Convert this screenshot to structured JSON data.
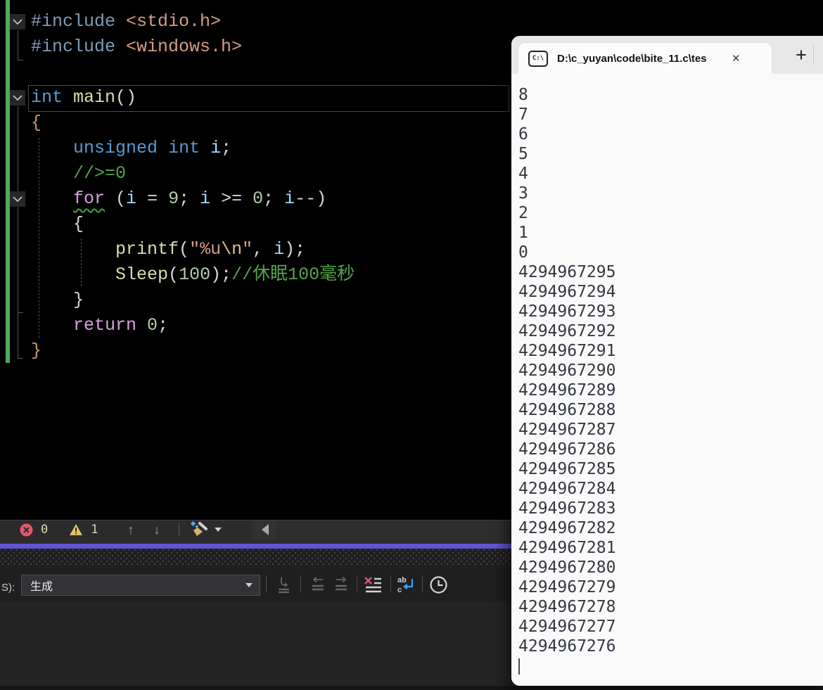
{
  "colors": {
    "accent_purple": "#6254d1",
    "change_bar_green": "#4fa95a",
    "error_red": "#e0566b",
    "warning_yellow": "#e5c260",
    "console_bg": "#fafafa",
    "console_text": "#343841",
    "editor_bg": "#000000"
  },
  "editor": {
    "token_colors": {
      "pp": "#7f9cb8",
      "str": "#d69d85",
      "esc": "#dfc284",
      "kw": "#569cd6",
      "ctrl": "#d8a0df",
      "fn": "#dcdcaa",
      "var": "#9cdcfe",
      "num": "#b5cea8",
      "cmt": "#57a64a",
      "pun": "#d8d8d8",
      "brace": "#cf9867"
    },
    "code_lines": [
      [
        {
          "t": "#include ",
          "c": "pp"
        },
        {
          "t": "<stdio.h>",
          "c": "str"
        }
      ],
      [
        {
          "t": "#include ",
          "c": "pp"
        },
        {
          "t": "<windows.h>",
          "c": "str"
        }
      ],
      [],
      [
        {
          "t": "int",
          "c": "kw"
        },
        {
          "t": " ",
          "c": "pun"
        },
        {
          "t": "main",
          "c": "fn"
        },
        {
          "t": "()",
          "c": "pun"
        }
      ],
      [
        {
          "t": "{",
          "c": "brace"
        }
      ],
      [
        {
          "t": "    ",
          "c": "pun"
        },
        {
          "t": "unsigned",
          "c": "kw"
        },
        {
          "t": " ",
          "c": "pun"
        },
        {
          "t": "int",
          "c": "kw"
        },
        {
          "t": " ",
          "c": "pun"
        },
        {
          "t": "i",
          "c": "var"
        },
        {
          "t": ";",
          "c": "pun"
        }
      ],
      [
        {
          "t": "    ",
          "c": "pun"
        },
        {
          "t": "//>=0",
          "c": "cmt"
        }
      ],
      [
        {
          "t": "    ",
          "c": "pun"
        },
        {
          "t": "for",
          "c": "ctrl",
          "squiggle": true
        },
        {
          "t": " (",
          "c": "pun"
        },
        {
          "t": "i",
          "c": "var"
        },
        {
          "t": " = ",
          "c": "pun"
        },
        {
          "t": "9",
          "c": "num"
        },
        {
          "t": "; ",
          "c": "pun"
        },
        {
          "t": "i",
          "c": "var"
        },
        {
          "t": " >= ",
          "c": "pun"
        },
        {
          "t": "0",
          "c": "num"
        },
        {
          "t": "; ",
          "c": "pun"
        },
        {
          "t": "i",
          "c": "var"
        },
        {
          "t": "--)",
          "c": "pun"
        }
      ],
      [
        {
          "t": "    {",
          "c": "pun"
        }
      ],
      [
        {
          "t": "        ",
          "c": "pun"
        },
        {
          "t": "printf",
          "c": "fn"
        },
        {
          "t": "(",
          "c": "pun"
        },
        {
          "t": "\"%u",
          "c": "str"
        },
        {
          "t": "\\n",
          "c": "esc"
        },
        {
          "t": "\"",
          "c": "str"
        },
        {
          "t": ", ",
          "c": "pun"
        },
        {
          "t": "i",
          "c": "var"
        },
        {
          "t": ");",
          "c": "pun"
        }
      ],
      [
        {
          "t": "        ",
          "c": "pun"
        },
        {
          "t": "Sleep",
          "c": "fn"
        },
        {
          "t": "(",
          "c": "pun"
        },
        {
          "t": "100",
          "c": "num"
        },
        {
          "t": ");",
          "c": "pun"
        },
        {
          "t": "//休眠100毫秒",
          "c": "cmt"
        }
      ],
      [
        {
          "t": "    }",
          "c": "pun"
        }
      ],
      [
        {
          "t": "    ",
          "c": "pun"
        },
        {
          "t": "return",
          "c": "ctrl"
        },
        {
          "t": " ",
          "c": "pun"
        },
        {
          "t": "0",
          "c": "num"
        },
        {
          "t": ";",
          "c": "pun"
        }
      ],
      [
        {
          "t": "}",
          "c": "brace"
        }
      ]
    ]
  },
  "diagnostics_bar": {
    "error_count": "0",
    "warning_count": "1"
  },
  "output_panel": {
    "source_label": "S):",
    "combo_value": "生成"
  },
  "console": {
    "tab_title": "D:\\c_yuyan\\code\\bite_11.c\\tes",
    "new_tab_label": "+",
    "close_label": "✕",
    "prompt_icon_text": "C:\\",
    "output_lines": [
      "8",
      "7",
      "6",
      "5",
      "4",
      "3",
      "2",
      "1",
      "0",
      "4294967295",
      "4294967294",
      "4294967293",
      "4294967292",
      "4294967291",
      "4294967290",
      "4294967289",
      "4294967288",
      "4294967287",
      "4294967286",
      "4294967285",
      "4294967284",
      "4294967283",
      "4294967282",
      "4294967281",
      "4294967280",
      "4294967279",
      "4294967278",
      "4294967277",
      "4294967276"
    ]
  },
  "icons": {
    "fold-chevron-icon": "∨",
    "errors-icon": "circle-x",
    "warnings-icon": "triangle-!",
    "prev-issue-icon": "↑",
    "next-issue-icon": "↓",
    "code-cleanup-broom-icon": "broom",
    "dropdown-caret-icon": "▼",
    "scroll-left-icon": "◀",
    "goto-location-icon": "curved-arrow-lines",
    "prev-message-icon": "←lines",
    "next-message-icon": "→lines",
    "clear-all-icon": "red-x-lines",
    "word-wrap-icon": "ab-c-return",
    "timestamp-clock-icon": "clock",
    "cmd-prompt-icon": "C:\\"
  }
}
